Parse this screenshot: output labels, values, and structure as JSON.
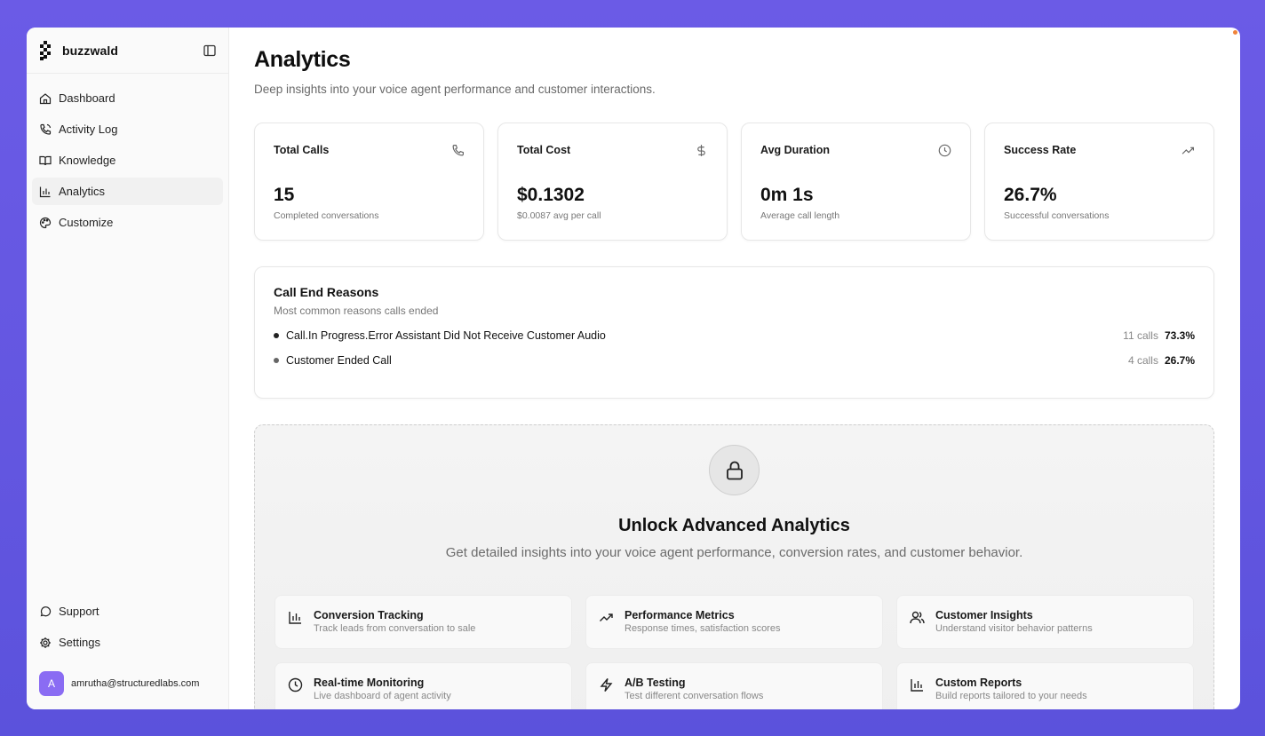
{
  "brand": {
    "name": "buzzwald"
  },
  "sidebar": {
    "items": [
      {
        "label": "Dashboard",
        "icon": "home-icon"
      },
      {
        "label": "Activity Log",
        "icon": "phone-icon"
      },
      {
        "label": "Knowledge",
        "icon": "book-icon"
      },
      {
        "label": "Analytics",
        "icon": "bar-chart-icon",
        "active": true
      },
      {
        "label": "Customize",
        "icon": "palette-icon"
      }
    ],
    "bottom_items": [
      {
        "label": "Support",
        "icon": "chat-icon"
      },
      {
        "label": "Settings",
        "icon": "gear-icon"
      }
    ],
    "user": {
      "initial": "A",
      "email": "amrutha@structuredlabs.com"
    }
  },
  "main": {
    "title": "Analytics",
    "subtitle": "Deep insights into your voice agent performance and customer interactions.",
    "stats": [
      {
        "label": "Total Calls",
        "value": "15",
        "sub": "Completed conversations",
        "icon": "phone-icon"
      },
      {
        "label": "Total Cost",
        "value": "$0.1302",
        "sub": "$0.0087 avg per call",
        "icon": "dollar-icon"
      },
      {
        "label": "Avg Duration",
        "value": "0m 1s",
        "sub": "Average call length",
        "icon": "clock-icon"
      },
      {
        "label": "Success Rate",
        "value": "26.7%",
        "sub": "Successful conversations",
        "icon": "trending-up-icon"
      }
    ],
    "reasons": {
      "title": "Call End Reasons",
      "subtitle": "Most common reasons calls ended",
      "rows": [
        {
          "label": "Call.In Progress.Error Assistant Did Not Receive Customer Audio",
          "count": "11 calls",
          "pct": "73.3%"
        },
        {
          "label": "Customer Ended Call",
          "count": "4 calls",
          "pct": "26.7%"
        }
      ]
    },
    "advanced": {
      "title": "Unlock Advanced Analytics",
      "subtitle": "Get detailed insights into your voice agent performance, conversion rates, and customer behavior.",
      "features": [
        {
          "title": "Conversion Tracking",
          "desc": "Track leads from conversation to sale",
          "icon": "bar-chart-icon"
        },
        {
          "title": "Performance Metrics",
          "desc": "Response times, satisfaction scores",
          "icon": "trending-up-icon"
        },
        {
          "title": "Customer Insights",
          "desc": "Understand visitor behavior patterns",
          "icon": "users-icon"
        },
        {
          "title": "Real-time Monitoring",
          "desc": "Live dashboard of agent activity",
          "icon": "clock-icon"
        },
        {
          "title": "A/B Testing",
          "desc": "Test different conversation flows",
          "icon": "zap-icon"
        },
        {
          "title": "Custom Reports",
          "desc": "Build reports tailored to your needs",
          "icon": "bar-chart-icon"
        }
      ]
    }
  }
}
